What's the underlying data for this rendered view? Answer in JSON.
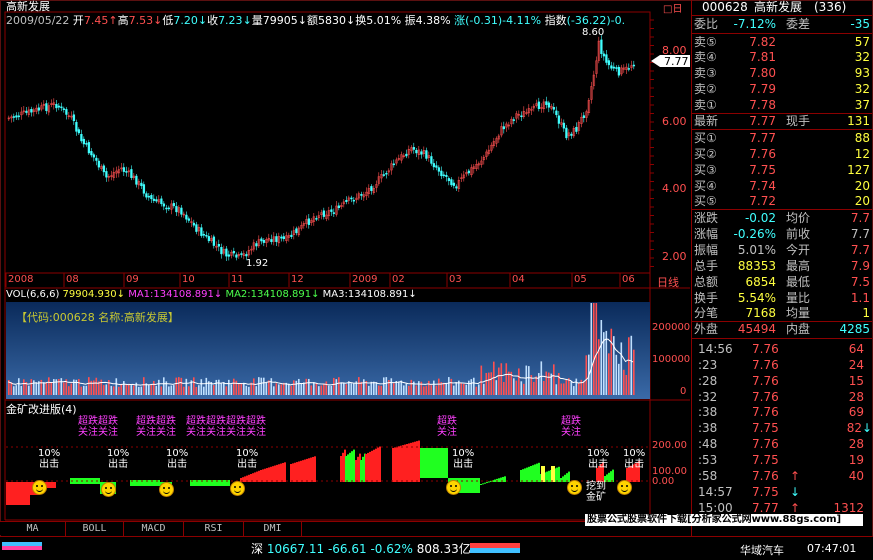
{
  "window": {
    "title": "高新发展"
  },
  "header": {
    "date": "2009/05/22",
    "open_label": "开",
    "open": "7.45",
    "high_label": "高",
    "high": "7.53",
    "low_label": "低",
    "low": "7.20",
    "close_label": "收",
    "close": "7.23",
    "volume_label": "量",
    "volume": "79905",
    "amount_label": "额",
    "amount": "5830",
    "turnover_label": "换",
    "turnover": "5.01%",
    "amplitude_label": "振",
    "amplitude": "4.38%",
    "change_label": "涨",
    "change": "(-0.31)-4.11%",
    "index_label": "指数",
    "index": "(-36.22)-0."
  },
  "price_axis": {
    "ticks": [
      "8.00",
      "6.00",
      "4.00",
      "2.00"
    ],
    "current_price": "7.77",
    "high_marker": "8.60",
    "low_marker": "1.92"
  },
  "time_axis": {
    "labels": [
      "2008",
      "08",
      "09",
      "10",
      "11",
      "12",
      "2009",
      "02",
      "03",
      "04",
      "05",
      "06"
    ],
    "period": "日线"
  },
  "volume_panel": {
    "indicator": "VOL(6,6,6)",
    "vol_value": "79904.930",
    "ma1_label": "MA1:",
    "ma1": "134108.891",
    "ma2_label": "MA2:",
    "ma2": "134108.891",
    "ma3_label": "MA3:",
    "ma3": "134108.891",
    "info": "【代码:000628 名称:高新发展】",
    "ticks": [
      "200000",
      "100000",
      "0"
    ]
  },
  "indicator_panel": {
    "title": "金矿改进版(4)",
    "ticks": [
      "200.00",
      "100.00",
      "0.00"
    ],
    "signal_label": "超跌",
    "signal_label_2": "关注",
    "pct_label": "10%",
    "pct_label_2": "出击",
    "gold_label": "挖到",
    "gold_label_2": "金矿"
  },
  "bottom_tabs": [
    "MA",
    "BOLL",
    "MACD",
    "RSI",
    "DMI"
  ],
  "right_panel": {
    "code": "000628",
    "name": "高新发展",
    "count": "(336)",
    "weibi_label": "委比",
    "weibi": "-7.12%",
    "weicha_label": "委差",
    "weicha": "-35",
    "asks": [
      {
        "label": "卖⑤",
        "price": "7.82",
        "vol": "57"
      },
      {
        "label": "卖④",
        "price": "7.81",
        "vol": "32"
      },
      {
        "label": "卖③",
        "price": "7.80",
        "vol": "93"
      },
      {
        "label": "卖②",
        "price": "7.79",
        "vol": "32"
      },
      {
        "label": "卖①",
        "price": "7.78",
        "vol": "37"
      }
    ],
    "last_label": "最新",
    "last": "7.77",
    "xianshou_label": "现手",
    "xianshou": "131",
    "bids": [
      {
        "label": "买①",
        "price": "7.77",
        "vol": "88"
      },
      {
        "label": "买②",
        "price": "7.76",
        "vol": "12"
      },
      {
        "label": "买③",
        "price": "7.75",
        "vol": "127"
      },
      {
        "label": "买④",
        "price": "7.74",
        "vol": "20"
      },
      {
        "label": "买⑤",
        "price": "7.72",
        "vol": "20"
      }
    ],
    "stats": [
      {
        "l1": "涨跌",
        "v1": "-0.02",
        "l2": "均价",
        "v2": "7.7"
      },
      {
        "l1": "涨幅",
        "v1": "-0.26%",
        "l2": "前收",
        "v2": "7.7"
      },
      {
        "l1": "振幅",
        "v1": "5.01%",
        "l2": "今开",
        "v2": "7.7"
      },
      {
        "l1": "总手",
        "v1": "88353",
        "l2": "最高",
        "v2": "7.9"
      },
      {
        "l1": "总额",
        "v1": "6854",
        "l2": "最低",
        "v2": "7.5"
      },
      {
        "l1": "换手",
        "v1": "5.54%",
        "l2": "量比",
        "v2": "1.1"
      },
      {
        "l1": "分笔",
        "v1": "7168",
        "l2": "均量",
        "v2": "1"
      }
    ],
    "outer_label": "外盘",
    "outer": "45494",
    "inner_label": "内盘",
    "inner": "4285",
    "ticks": [
      {
        "time": "14:56",
        "price": "7.76",
        "vol": "64",
        "dir": ""
      },
      {
        "time": ":23",
        "price": "7.76",
        "vol": "24",
        "dir": ""
      },
      {
        "time": ":28",
        "price": "7.76",
        "vol": "15",
        "dir": ""
      },
      {
        "time": ":32",
        "price": "7.76",
        "vol": "28",
        "dir": ""
      },
      {
        "time": ":38",
        "price": "7.76",
        "vol": "69",
        "dir": ""
      },
      {
        "time": ":38",
        "price": "7.75",
        "vol": "82",
        "dir": "↓"
      },
      {
        "time": ":48",
        "price": "7.76",
        "vol": "28",
        "dir": ""
      },
      {
        "time": ":53",
        "price": "7.75",
        "vol": "19",
        "dir": ""
      },
      {
        "time": ":58",
        "price": "7.76",
        "vol": "40",
        "dir": "↑"
      },
      {
        "time": "14:57",
        "price": "7.75",
        "vol": "",
        "dir": "↓"
      },
      {
        "time": "15:00",
        "price": "7.77",
        "vol": "1312",
        "dir": "↑"
      }
    ]
  },
  "watermark": {
    "text": "股票公式股票软件下载[分析家公式网www.88gs.com]"
  },
  "status_bar": {
    "index_name": "深",
    "index_value": "10667.11",
    "index_change": "-66.61",
    "index_pct": "-0.62%",
    "index_amount": "808.33亿",
    "news": "华域汽车",
    "time": "07:47:01"
  },
  "colors": {
    "up": "#ff5050",
    "down": "#40ffff",
    "bg": "#000000",
    "border": "#8b0000",
    "ma1": "#ff40ff",
    "ma2": "#4cff4c",
    "ma3": "#ffffff"
  }
}
